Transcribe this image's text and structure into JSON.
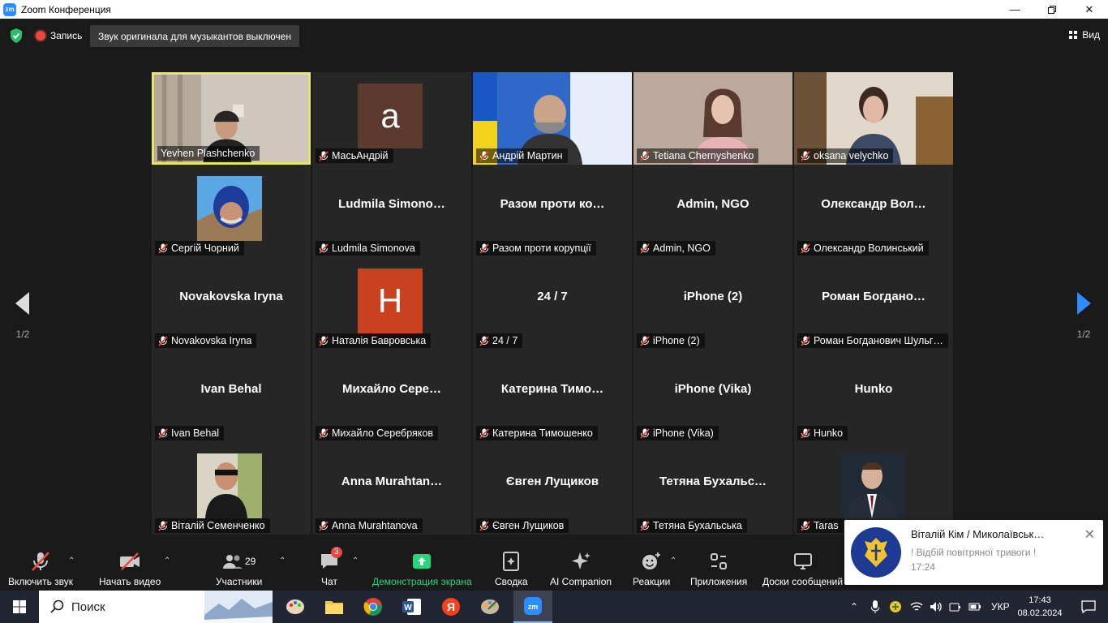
{
  "window": {
    "app_icon": "zm",
    "title": "Zoom Конференция",
    "controls": [
      "minimize-icon",
      "restore-icon",
      "close-icon"
    ]
  },
  "topbar": {
    "security_icon": "shield-check-icon",
    "recording_label": "Запись",
    "original_sound_label": "Звук оригинала для музыкантов выключен",
    "view_label": "Вид"
  },
  "gallery": {
    "page_left": "1/2",
    "page_right": "1/2",
    "tiles": [
      {
        "display": "video",
        "label": "Yevhen Plashchenko",
        "muted": false,
        "active": true
      },
      {
        "display": "avatar",
        "avatar_letter": "a",
        "avatar_color": "#5c3b2e",
        "label": "МасьАндрій",
        "muted": true
      },
      {
        "display": "video",
        "label": "Андрій Мартин",
        "muted": true
      },
      {
        "display": "video",
        "label": "Tetiana Chernyshenko",
        "muted": true
      },
      {
        "display": "video",
        "label": "oksana velychko",
        "muted": true
      },
      {
        "display": "photo",
        "label": "Сергій Чорний",
        "muted": true
      },
      {
        "display": "name",
        "name_text": "Ludmila  Simono…",
        "label": "Ludmila Simonova",
        "muted": true
      },
      {
        "display": "name",
        "name_text": "Разом  проти  ко…",
        "label": "Разом проти корупції",
        "muted": true
      },
      {
        "display": "name",
        "name_text": "Admin, NGO",
        "label": "Admin, NGO",
        "muted": true
      },
      {
        "display": "name",
        "name_text": "Олександр  Вол…",
        "label": "Олександр Волинський",
        "muted": true
      },
      {
        "display": "name",
        "name_text": "Novakovska Iryna",
        "label": "Novakovska Iryna",
        "muted": true
      },
      {
        "display": "avatar",
        "avatar_letter": "H",
        "avatar_color": "#c9411e",
        "label": "Наталія Бавровська",
        "muted": true
      },
      {
        "display": "name",
        "name_text": "24 / 7",
        "label": "24 / 7",
        "muted": true
      },
      {
        "display": "name",
        "name_text": "iPhone (2)",
        "label": "iPhone (2)",
        "muted": true
      },
      {
        "display": "name",
        "name_text": "Роман  Богдано…",
        "label": "Роман Богданович Шульг…",
        "muted": true
      },
      {
        "display": "name",
        "name_text": "Ivan Behal",
        "label": "Ivan Behal",
        "muted": true
      },
      {
        "display": "name",
        "name_text": "Михайло  Сере…",
        "label": "Михайло Серебряков",
        "muted": true
      },
      {
        "display": "name",
        "name_text": "Катерина  Тимо…",
        "label": "Катерина Тимошенко",
        "muted": true
      },
      {
        "display": "name",
        "name_text": "iPhone (Vika)",
        "label": "iPhone (Vika)",
        "muted": true
      },
      {
        "display": "name",
        "name_text": "Hunko",
        "label": "Hunko",
        "muted": true
      },
      {
        "display": "photo",
        "label": "Віталій Семенченко",
        "muted": true
      },
      {
        "display": "name",
        "name_text": "Anna  Murahtan…",
        "label": "Anna Murahtanova",
        "muted": true
      },
      {
        "display": "name",
        "name_text": "Євген  Лущиков",
        "label": "Євген Лущиков",
        "muted": true
      },
      {
        "display": "name",
        "name_text": "Тетяна  Бухальс…",
        "label": "Тетяна Бухальська",
        "muted": true
      },
      {
        "display": "photo",
        "label": "Taras",
        "muted": true
      }
    ]
  },
  "toolbar": {
    "unmute_label": "Включить звук",
    "start_video_label": "Начать видео",
    "participants_label": "Участники",
    "participants_count": "29",
    "chat_label": "Чат",
    "chat_badge": "3",
    "share_label": "Демонстрация экрана",
    "summary_label": "Сводка",
    "ai_label": "AI Companion",
    "reactions_label": "Реакции",
    "apps_label": "Приложения",
    "whiteboards_label": "Доски сообщений"
  },
  "notification": {
    "title": "Віталій Кім / Миколаївськ…",
    "body": "! Відбій повітряної тривоги !",
    "time": "17:24",
    "icon": "coat-of-arms-icon"
  },
  "taskbar": {
    "search_placeholder": "Поиск",
    "apps": [
      "paint-icon",
      "file-explorer-icon",
      "chrome-icon",
      "word-icon",
      "yandex-icon",
      "paint3d-icon",
      "zoom-icon"
    ],
    "language": "УКР",
    "time": "17:43",
    "date": "08.02.2024"
  },
  "colors": {
    "accent": "#2d8cff",
    "active_speaker_border": "#e4e95a",
    "share_green": "#26d67c",
    "muted_red": "#e8483d"
  }
}
